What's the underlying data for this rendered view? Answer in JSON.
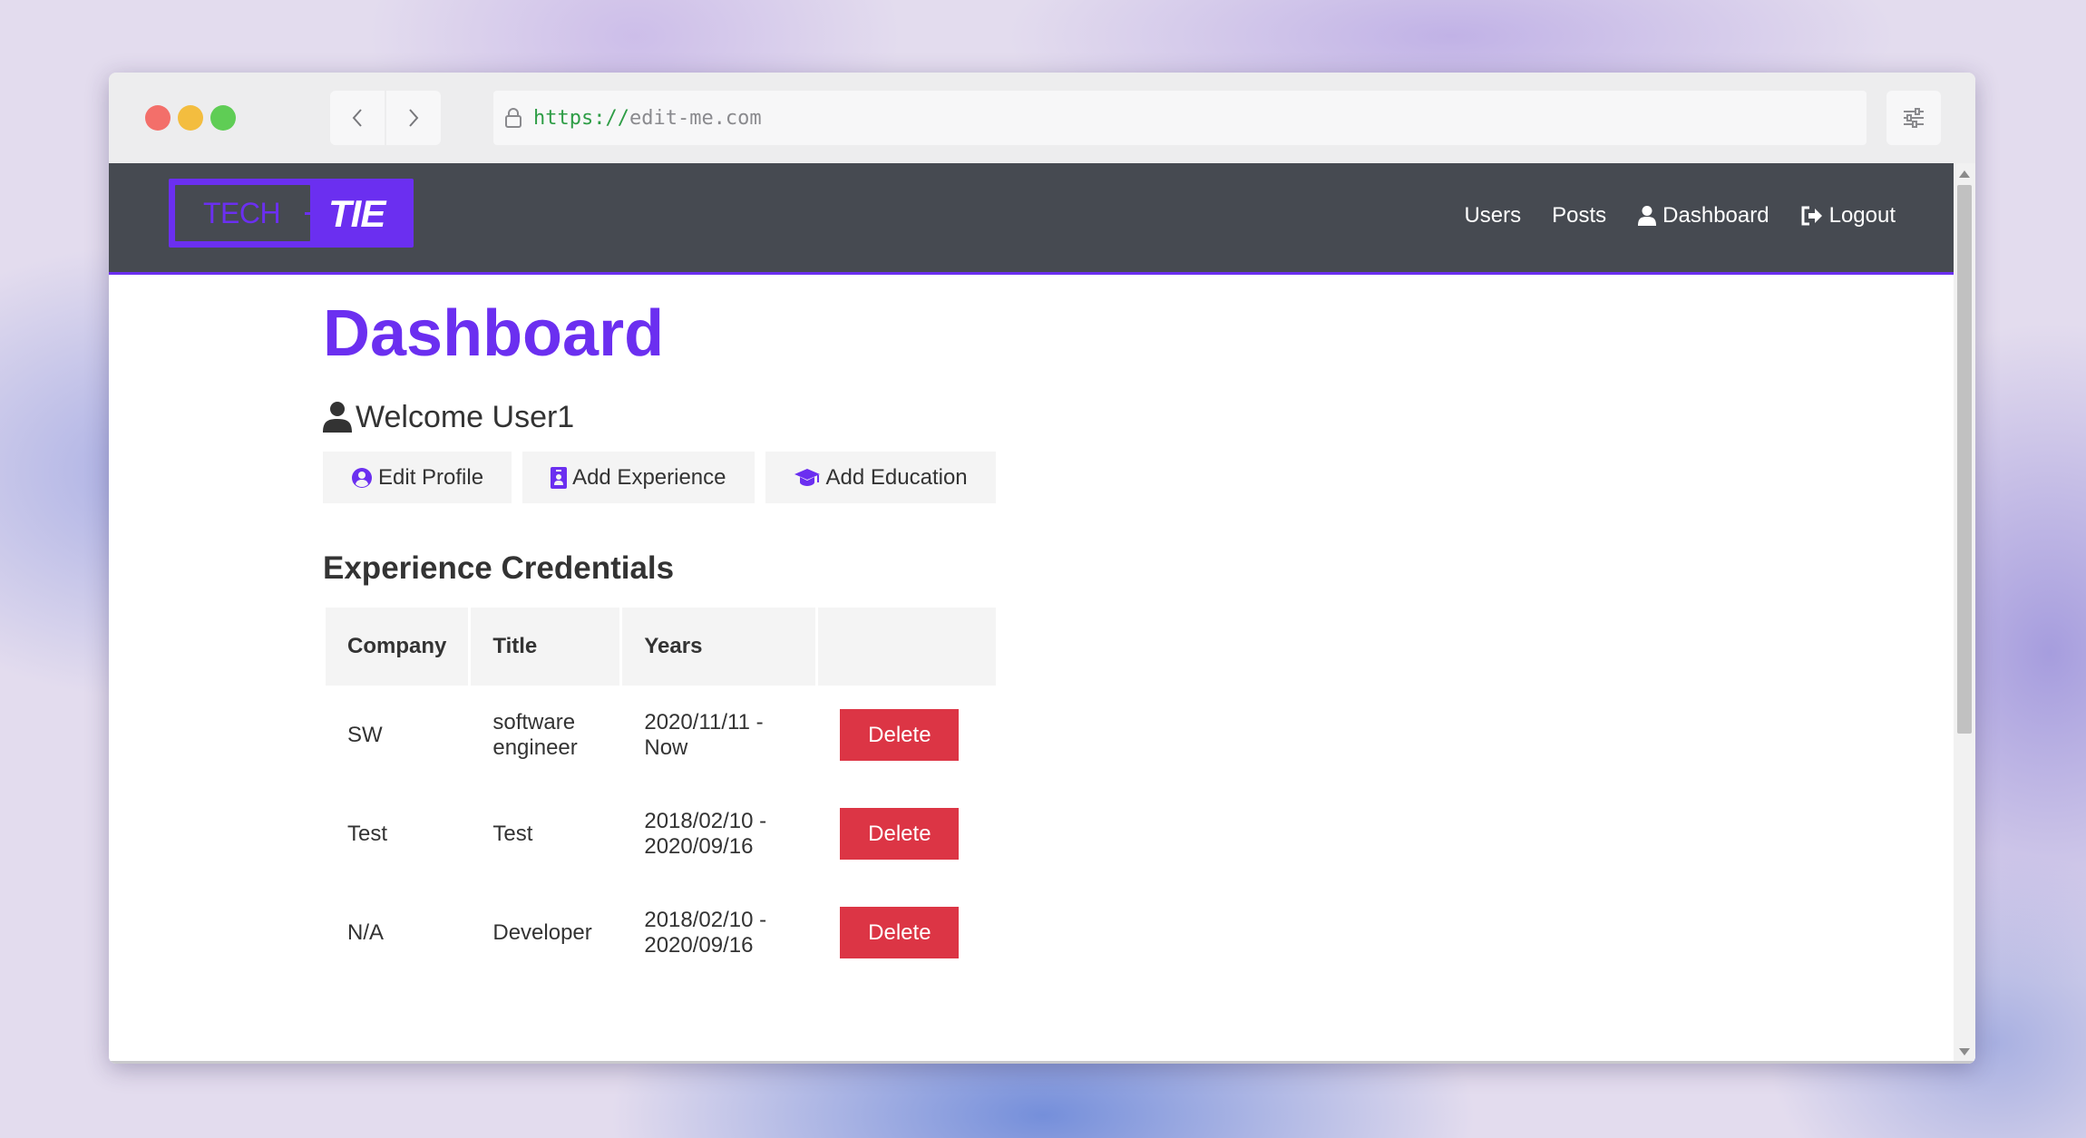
{
  "browser": {
    "url_scheme": "https://",
    "url_host": "edit-me.com"
  },
  "navbar": {
    "logo": {
      "part1": "TECH",
      "part2": "TIE"
    },
    "links": [
      {
        "label": "Users"
      },
      {
        "label": "Posts"
      },
      {
        "label": "Dashboard",
        "icon": "user-icon"
      },
      {
        "label": "Logout",
        "icon": "sign-out-icon"
      }
    ]
  },
  "page": {
    "title": "Dashboard",
    "welcome": "Welcome User1",
    "actions": [
      {
        "label": "Edit Profile",
        "icon": "user-circle-icon"
      },
      {
        "label": "Add Experience",
        "icon": "id-badge-icon"
      },
      {
        "label": "Add Education",
        "icon": "graduation-cap-icon"
      }
    ],
    "experience_heading": "Experience Credentials",
    "experience_table": {
      "headers": [
        "Company",
        "Title",
        "Years",
        ""
      ],
      "rows": [
        {
          "company": "SW",
          "title": "software engineer",
          "years": "2020/11/11 - Now",
          "action": "Delete"
        },
        {
          "company": "Test",
          "title": "Test",
          "years": "2018/02/10 - 2020/09/16",
          "action": "Delete"
        },
        {
          "company": "N/A",
          "title": "Developer",
          "years": "2018/02/10 - 2020/09/16",
          "action": "Delete"
        }
      ]
    }
  },
  "colors": {
    "accent": "#6b2ff0",
    "navbar_bg": "#464a51",
    "danger": "#dc3545",
    "text": "#333333"
  }
}
